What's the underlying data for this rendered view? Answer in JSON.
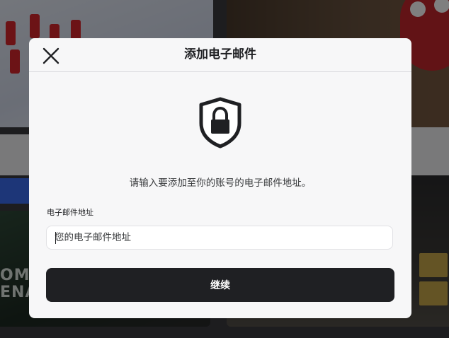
{
  "dialog": {
    "title": "添加电子邮件",
    "instruction": "请输入要添加至你的账号的电子邮件地址。",
    "email_label": "电子邮件地址",
    "email_placeholder": "您的电子邮件地址",
    "email_value": "",
    "continue_label": "继续",
    "icons": {
      "close": "close-icon",
      "shield": "shield-lock-icon"
    }
  },
  "background": {
    "thumbnail_text": "OMBA\nENA"
  },
  "colors": {
    "dialog_bg": "#f7f7f8",
    "primary_button": "#1f2023",
    "text": "#1f2023",
    "overlay": "rgba(0,0,0,0.5)"
  }
}
